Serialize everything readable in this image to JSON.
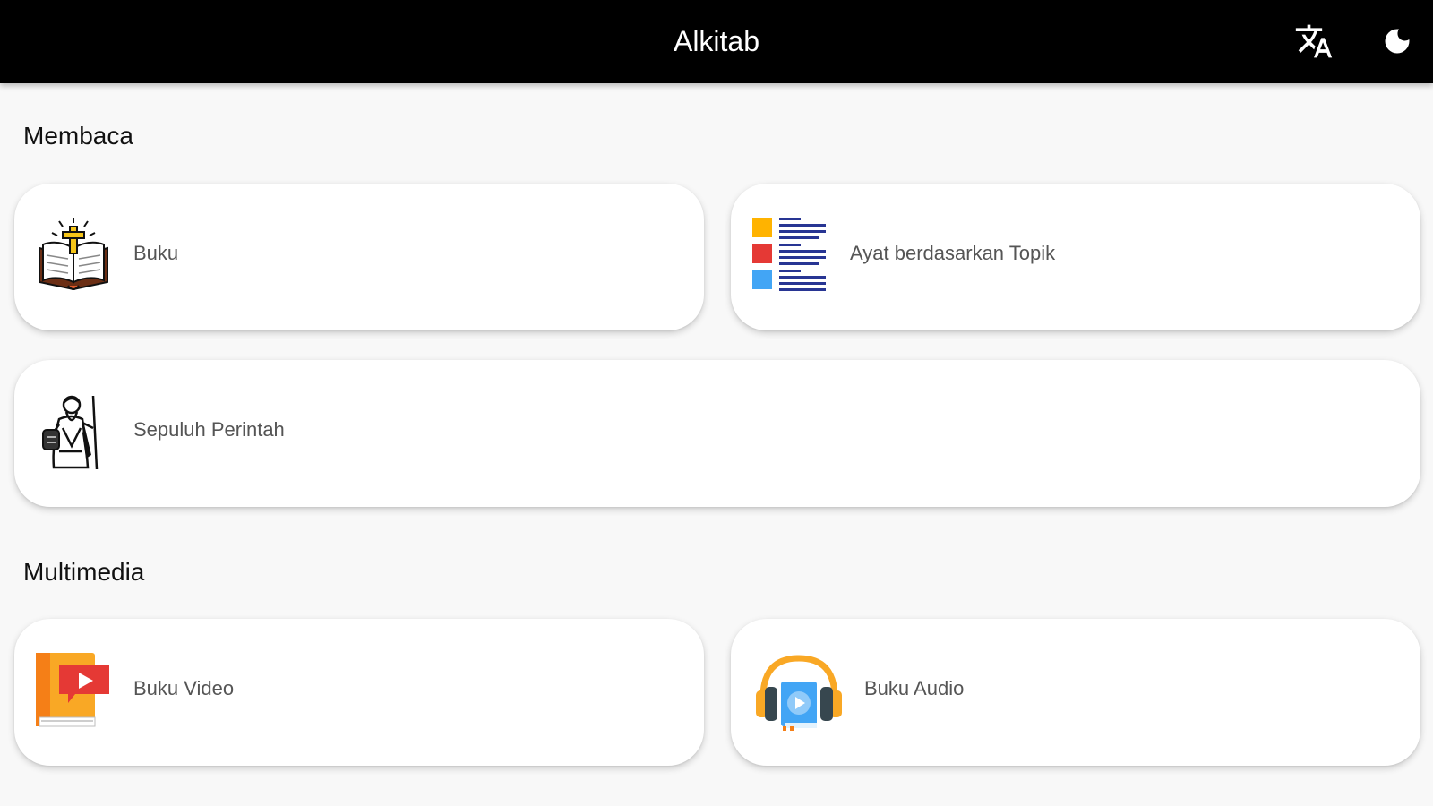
{
  "app": {
    "title": "Alkitab",
    "translate_icon": "translate-icon",
    "theme_icon": "moon-icon"
  },
  "sections": {
    "membaca": {
      "title": "Membaca",
      "cards": [
        {
          "label": "Buku",
          "icon": "bible-book-icon"
        },
        {
          "label": "Ayat berdasarkan Topik",
          "icon": "topic-list-icon"
        },
        {
          "label": "Sepuluh Perintah",
          "icon": "moses-icon"
        }
      ]
    },
    "multimedia": {
      "title": "Multimedia",
      "cards": [
        {
          "label": "Buku Video",
          "icon": "video-book-icon"
        },
        {
          "label": "Buku Audio",
          "icon": "audio-book-icon"
        }
      ]
    }
  },
  "colors": {
    "appbar": "#000000",
    "background": "#f8f8f8",
    "card": "#ffffff"
  }
}
